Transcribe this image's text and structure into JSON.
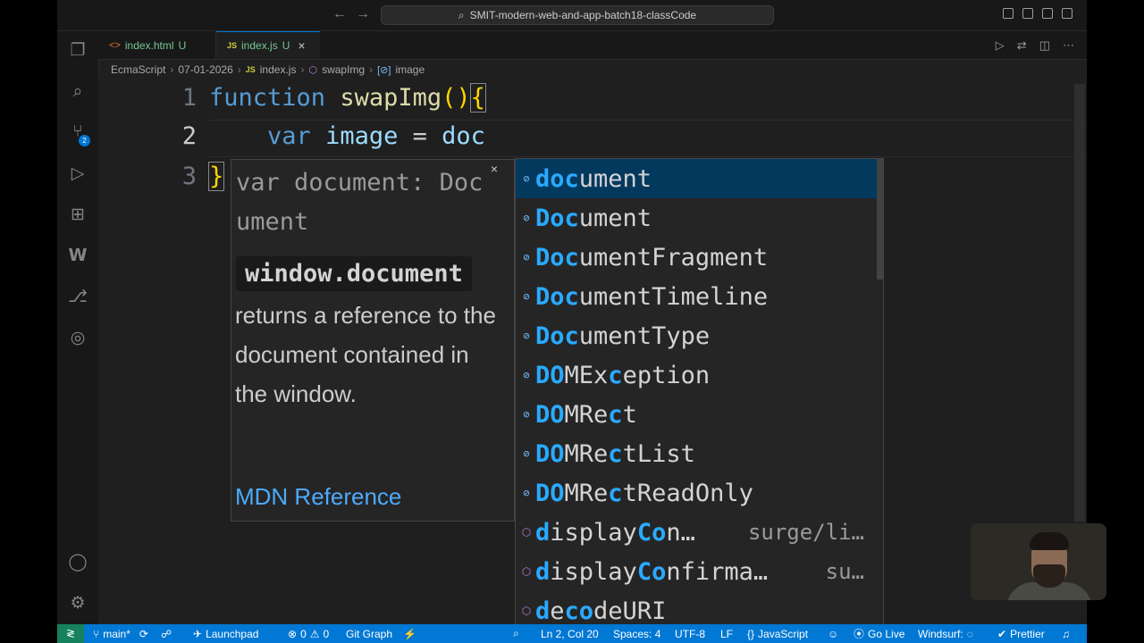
{
  "titlebar": {
    "search_text": "SMIT-modern-web-and-app-batch18-classCode",
    "back_icon": "arrow-left-icon",
    "forward_icon": "arrow-right-icon"
  },
  "activity_bar": {
    "items": [
      "explorer-icon",
      "search-icon",
      "source-control-icon",
      "run-debug-icon",
      "extensions-icon",
      "windsurf-icon",
      "git-graph-icon",
      "remote-explorer-icon"
    ],
    "scm_badge": "2",
    "bottom": [
      "account-icon",
      "settings-gear-icon"
    ]
  },
  "tabs": [
    {
      "label": "index.html",
      "status": "U",
      "icon": "<>",
      "active": false
    },
    {
      "label": "index.js",
      "status": "U",
      "icon": "JS",
      "active": true
    }
  ],
  "breadcrumb": {
    "parts": [
      "EcmaScript",
      "07-01-2026",
      "index.js",
      "swapImg",
      "image"
    ],
    "js_icon": "JS"
  },
  "editor": {
    "line_numbers": [
      "1",
      "2",
      "3"
    ],
    "line1": {
      "kw": "function",
      "name": "swapImg",
      "parens": "()",
      "brace": "{"
    },
    "line2": {
      "kw": "var",
      "ident": "image",
      "op": "=",
      "typed": "doc"
    },
    "line3": {
      "brace": "}"
    }
  },
  "hover": {
    "signature": "var document: Document",
    "code": "window.document",
    "description": "returns a reference to the document contained in the window.",
    "link": "MDN Reference",
    "close": "×"
  },
  "suggestions": [
    {
      "hl": "doc",
      "rest": "ument",
      "kind": "variable",
      "selected": true
    },
    {
      "hl": "Doc",
      "rest": "ument",
      "kind": "variable"
    },
    {
      "hl": "Doc",
      "rest": "umentFragment",
      "kind": "variable"
    },
    {
      "hl": "Doc",
      "rest": "umentTimeline",
      "kind": "variable"
    },
    {
      "hl": "Doc",
      "rest": "umentType",
      "kind": "variable"
    },
    {
      "parts": [
        [
          "DO",
          1
        ],
        [
          "MEx",
          0
        ],
        [
          "c",
          1
        ],
        [
          "eption",
          0
        ]
      ],
      "kind": "variable"
    },
    {
      "parts": [
        [
          "DO",
          1
        ],
        [
          "MRe",
          0
        ],
        [
          "c",
          1
        ],
        [
          "t",
          0
        ]
      ],
      "kind": "variable"
    },
    {
      "parts": [
        [
          "DO",
          1
        ],
        [
          "MRe",
          0
        ],
        [
          "c",
          1
        ],
        [
          "tList",
          0
        ]
      ],
      "kind": "variable"
    },
    {
      "parts": [
        [
          "DO",
          1
        ],
        [
          "MRe",
          0
        ],
        [
          "c",
          1
        ],
        [
          "tReadOnly",
          0
        ]
      ],
      "kind": "variable"
    },
    {
      "parts": [
        [
          "d",
          1
        ],
        [
          "isplay",
          0
        ],
        [
          "Co",
          1
        ],
        [
          "n…",
          0
        ]
      ],
      "detail": "surge/li…",
      "kind": "module"
    },
    {
      "parts": [
        [
          "d",
          1
        ],
        [
          "isplay",
          0
        ],
        [
          "Co",
          1
        ],
        [
          "nfirma…",
          0
        ]
      ],
      "detail": "su…",
      "kind": "module"
    },
    {
      "parts": [
        [
          "d",
          1
        ],
        [
          "e",
          0
        ],
        [
          "co",
          1
        ],
        [
          "deURI",
          0
        ]
      ],
      "kind": "method"
    }
  ],
  "statusbar": {
    "branch": "main*",
    "launchpad": "Launchpad",
    "errors": "0",
    "warnings": "0",
    "git_graph": "Git Graph",
    "position": "Ln 2, Col 20",
    "spaces": "Spaces: 4",
    "encoding": "UTF-8",
    "eol": "LF",
    "language": "JavaScript",
    "go_live": "Go Live",
    "windsurf": "Windsurf:",
    "prettier": "Prettier"
  },
  "colors": {
    "accent": "#0078d4",
    "status_bg": "#0078d4",
    "suggest_highlight": "#2aaaff",
    "keyword": "#569cd6",
    "function": "#dcdcaa"
  }
}
